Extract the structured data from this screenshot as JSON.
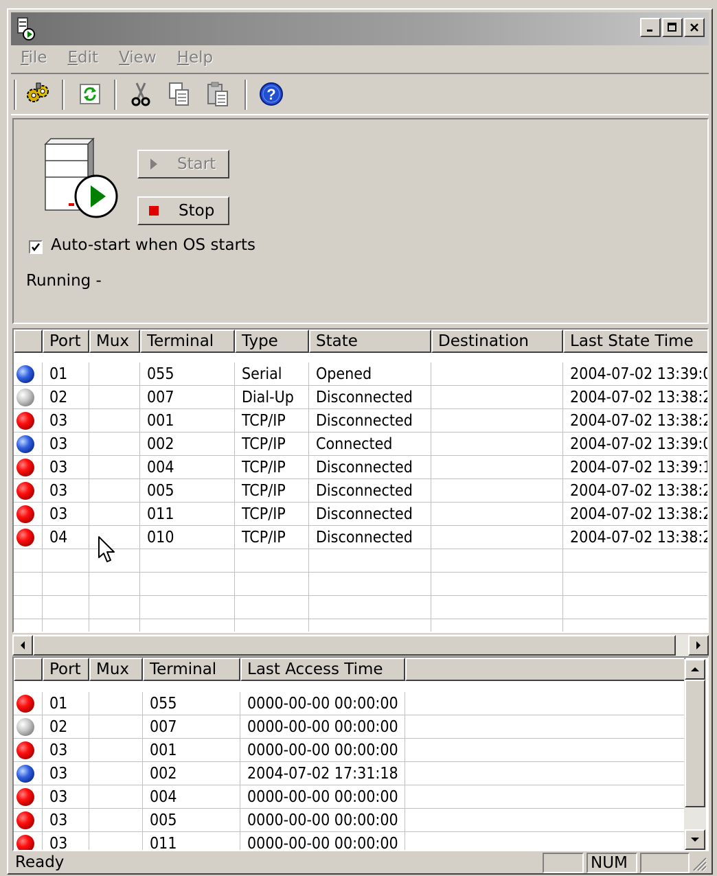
{
  "window": {
    "title": ""
  },
  "menu": [
    {
      "label": "File"
    },
    {
      "label": "Edit"
    },
    {
      "label": "View"
    },
    {
      "label": "Help"
    }
  ],
  "toolbar": {
    "items": [
      "settings-gears-icon",
      "refresh-icon",
      "cut-icon",
      "copy-icon",
      "paste-icon",
      "help-icon"
    ]
  },
  "control": {
    "start_label": "Start",
    "stop_label": "Stop",
    "autostart_label": "Auto-start when OS starts",
    "autostart_checked": true,
    "status_text": "Running -"
  },
  "ports_table": {
    "columns": [
      "Port",
      "Mux",
      "Terminal",
      "Type",
      "State",
      "Destination",
      "Last State Time"
    ],
    "rows": [
      {
        "status": "blue",
        "port": "01",
        "mux": "",
        "terminal": "055",
        "type": "Serial",
        "state": "Opened",
        "destination": "",
        "time": "2004-07-02 13:39:0"
      },
      {
        "status": "gray",
        "port": "02",
        "mux": "",
        "terminal": "007",
        "type": "Dial-Up",
        "state": "Disconnected",
        "destination": "",
        "time": "2004-07-02 13:38:2"
      },
      {
        "status": "red",
        "port": "03",
        "mux": "",
        "terminal": "001",
        "type": "TCP/IP",
        "state": "Disconnected",
        "destination": "",
        "time": "2004-07-02 13:38:2"
      },
      {
        "status": "blue",
        "port": "03",
        "mux": "",
        "terminal": "002",
        "type": "TCP/IP",
        "state": "Connected",
        "destination": "",
        "time": "2004-07-02 13:39:0"
      },
      {
        "status": "red",
        "port": "03",
        "mux": "",
        "terminal": "004",
        "type": "TCP/IP",
        "state": "Disconnected",
        "destination": "",
        "time": "2004-07-02 13:39:1"
      },
      {
        "status": "red",
        "port": "03",
        "mux": "",
        "terminal": "005",
        "type": "TCP/IP",
        "state": "Disconnected",
        "destination": "",
        "time": "2004-07-02 13:38:2"
      },
      {
        "status": "red",
        "port": "03",
        "mux": "",
        "terminal": "011",
        "type": "TCP/IP",
        "state": "Disconnected",
        "destination": "",
        "time": "2004-07-02 13:38:2"
      },
      {
        "status": "red",
        "port": "04",
        "mux": "",
        "terminal": "010",
        "type": "TCP/IP",
        "state": "Disconnected",
        "destination": "",
        "time": "2004-07-02 13:38:2"
      }
    ]
  },
  "access_table": {
    "columns": [
      "Port",
      "Mux",
      "Terminal",
      "Last Access Time"
    ],
    "rows": [
      {
        "status": "red",
        "port": "01",
        "mux": "",
        "terminal": "055",
        "time": "0000-00-00 00:00:00"
      },
      {
        "status": "gray",
        "port": "02",
        "mux": "",
        "terminal": "007",
        "time": "0000-00-00 00:00:00"
      },
      {
        "status": "red",
        "port": "03",
        "mux": "",
        "terminal": "001",
        "time": "0000-00-00 00:00:00"
      },
      {
        "status": "blue",
        "port": "03",
        "mux": "",
        "terminal": "002",
        "time": "2004-07-02 17:31:18"
      },
      {
        "status": "red",
        "port": "03",
        "mux": "",
        "terminal": "004",
        "time": "0000-00-00 00:00:00"
      },
      {
        "status": "red",
        "port": "03",
        "mux": "",
        "terminal": "005",
        "time": "0000-00-00 00:00:00"
      },
      {
        "status": "red",
        "port": "03",
        "mux": "",
        "terminal": "011",
        "time": "0000-00-00 00:00:00"
      }
    ]
  },
  "statusbar": {
    "text": "Ready",
    "num": "NUM"
  },
  "colors": {
    "face": "#d4d0c8",
    "status_red": "#e00000",
    "status_blue": "#2050d0",
    "status_gray": "#a0a0a0",
    "play_green": "#008000"
  }
}
